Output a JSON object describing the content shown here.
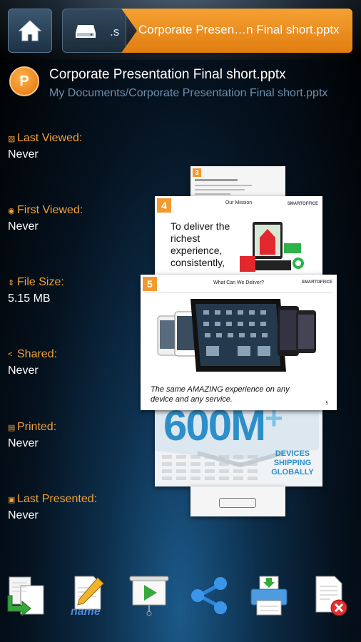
{
  "breadcrumb": {
    "truncated": ".s",
    "current": "Corporate Presen…n Final short.pptx"
  },
  "file": {
    "avatar_letter": "P",
    "name": "Corporate Presentation Final short.pptx",
    "path": "My Documents/Corporate Presentation Final short.pptx"
  },
  "details": [
    {
      "label": "Last Viewed:",
      "value": "Never",
      "icon": "calendar-icon"
    },
    {
      "label": "First Viewed:",
      "value": "Never",
      "icon": "eye-icon"
    },
    {
      "label": "File Size:",
      "value": "5.15 MB",
      "icon": "file-size-icon"
    },
    {
      "label": "Shared:",
      "value": "Never",
      "icon": "share-icon"
    },
    {
      "label": "Printed:",
      "value": "Never",
      "icon": "printer-icon"
    },
    {
      "label": "Last Presented:",
      "value": "Never",
      "icon": "present-icon"
    }
  ],
  "slides": {
    "s3": {
      "num": "3"
    },
    "s4": {
      "num": "4",
      "title": "Our Mission",
      "text": "To deliver the richest experience, consistently,"
    },
    "s5": {
      "num": "5",
      "title": "What Can We Deliver?",
      "caption": "The same AMAZING experience on any device and any service.",
      "page": "5"
    },
    "s6": {
      "big": "600M",
      "plus": "+",
      "sub": "DEVICES SHIPPING GLOBALLY"
    },
    "brand": "SMARTOFFICE"
  },
  "toolbar": [
    {
      "name": "copy-file-button",
      "icon": "copy-icon"
    },
    {
      "name": "rename-button",
      "icon": "rename-icon",
      "label": "name"
    },
    {
      "name": "present-button",
      "icon": "projector-icon"
    },
    {
      "name": "share-button",
      "icon": "share-icon"
    },
    {
      "name": "print-button",
      "icon": "printer-icon"
    },
    {
      "name": "delete-button",
      "icon": "delete-file-icon"
    }
  ],
  "colors": {
    "accent": "#f29a2e",
    "label": "#f0a23a",
    "path": "#6d8eae"
  }
}
